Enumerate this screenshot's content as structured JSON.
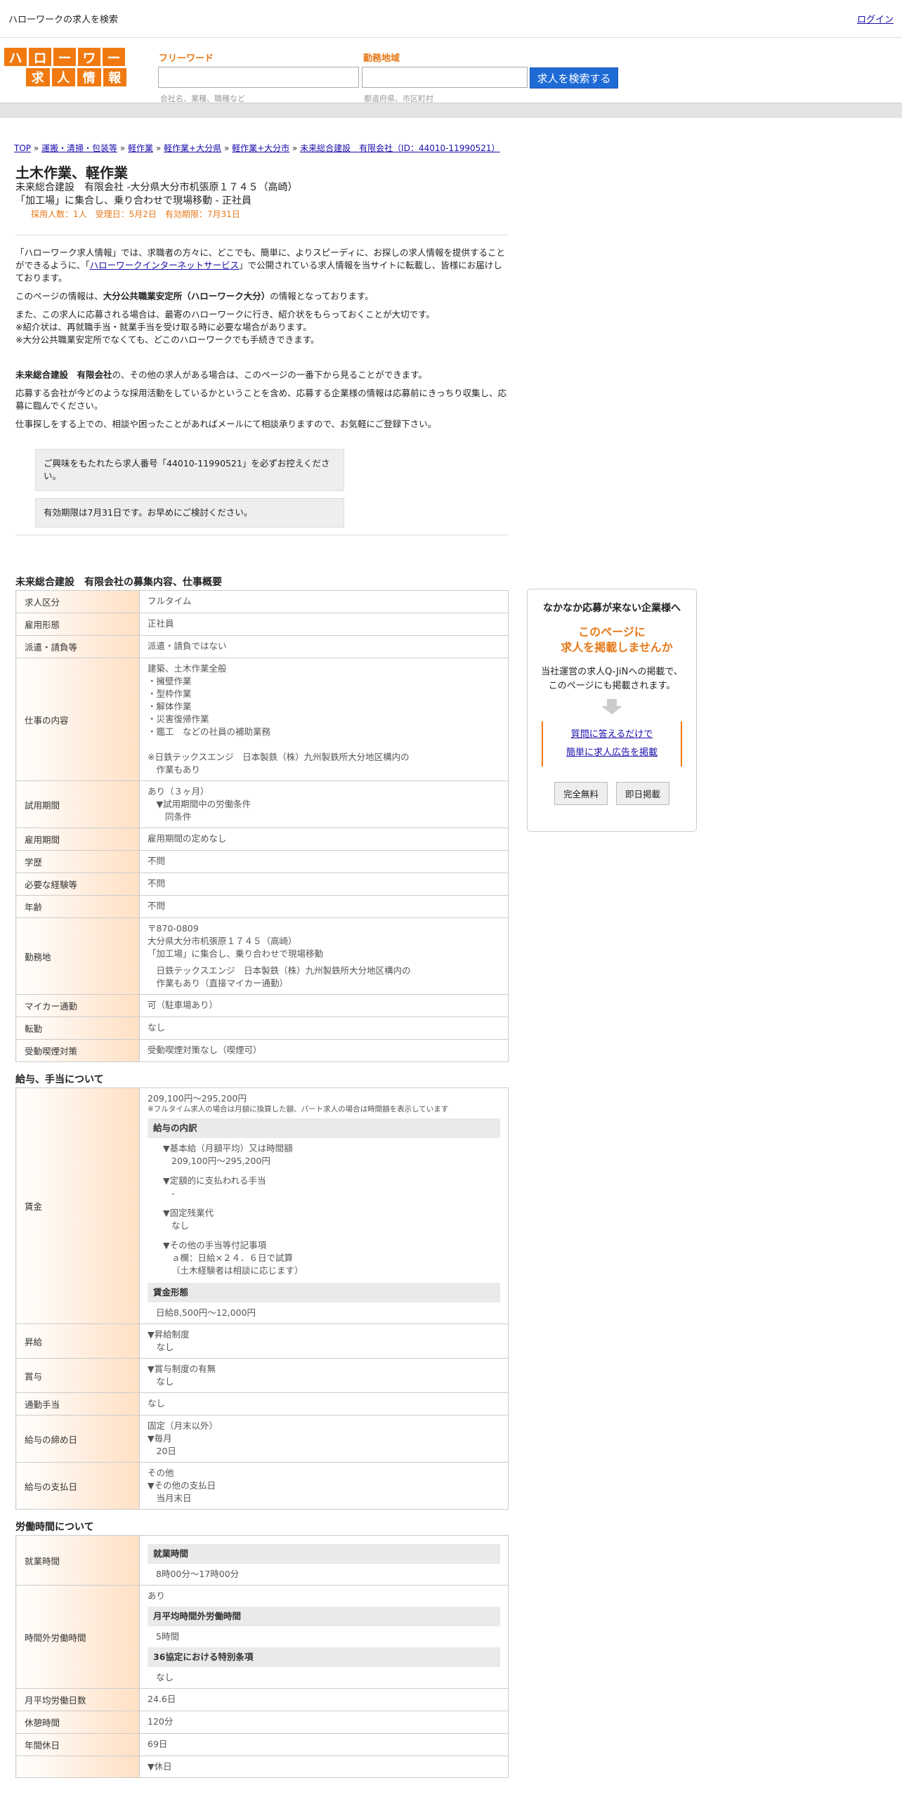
{
  "top": {
    "title": "ハローワークの求人を検索",
    "login": "ログイン"
  },
  "logo": {
    "row1": [
      "ハ",
      "ロ",
      "ー",
      "ワ",
      "ー",
      "ク"
    ],
    "row2": [
      "求",
      "人",
      "情",
      "報"
    ]
  },
  "search": {
    "freeword_label": "フリーワード",
    "freeword_placeholder": "会社名、業種、職種など",
    "area_label": "勤務地域",
    "area_placeholder": "都道府県、市区町村",
    "button": "求人を検索する"
  },
  "breadcrumb": {
    "top": "TOP",
    "sep": "»",
    "c1": "運搬・清掃・包装等",
    "c2": "軽作業",
    "c3": "軽作業+大分県",
    "c4": "軽作業+大分市",
    "c5": "未来総合建設　有限会社（ID：44010-11990521）"
  },
  "job": {
    "title": "土木作業、軽作業",
    "company_line": "未来総合建設　有限会社 -大分県大分市机張原１７４５（高崎）",
    "subtitle": "「加工場」に集合し、乗り合わせで現場移動 - 正社員",
    "meta": "採用人数：1人　受理日：5月2日　有効期限：7月31日"
  },
  "intro": {
    "p1a": "「ハローワーク求人情報」では、求職者の方々に、どこでも、簡単に、よりスピーディに、お探しの求人情報を提供することができるように、「",
    "p1link": "ハローワークインターネットサービス",
    "p1b": "」で公開されている求人情報を当サイトに転載し、皆様にお届けしております。",
    "p2a": "このページの情報は、",
    "p2b": "大分公共職業安定所（ハローワーク大分）",
    "p2c": "の情報となっております。",
    "p3": "また、この求人に応募される場合は、最寄のハローワークに行き、紹介状をもらっておくことが大切です。",
    "p3b": "※紹介状は、再就職手当・就業手当を受け取る時に必要な場合があります。",
    "p3c": "※大分公共職業安定所でなくても、どこのハローワークでも手続きできます。",
    "p4a": "未来総合建設　有限会社",
    "p4b": "の、その他の求人がある場合は、このページの一番下から見ることができます。",
    "p5": "応募する会社が今どのような採用活動をしているかということを含め、応募する企業様の情報は応募前にきっちり収集し、応募に臨んでください。",
    "p6": "仕事探しをする上での、相談や困ったことがあればメールにて相談承りますので、お気軽にご登録下さい。"
  },
  "notices": {
    "n1": "ご興味をもたれたら求人番号「44010-11990521」を必ずお控えください。",
    "n2": "有効期限は7月31日です。お早めにご検討ください。"
  },
  "sections": {
    "s1": "未来総合建設　有限会社の募集内容、仕事概要",
    "s2": "給与、手当について",
    "s3": "労働時間について"
  },
  "t1": {
    "r1": [
      "求人区分",
      "フルタイム"
    ],
    "r2": [
      "雇用形態",
      "正社員"
    ],
    "r3": [
      "派遣・請負等",
      "派遣・請負ではない"
    ],
    "r4h": "仕事の内容",
    "r4": [
      "建築、土木作業全般",
      "・擁壁作業",
      "・型枠作業",
      "・解体作業",
      "・災害復帰作業",
      "・鑑工　などの社員の補助業務",
      "",
      "※日鉄テックスエンジ　日本製鉄（株）九州製鉄所大分地区構内の",
      "　作業もあり"
    ],
    "r5h": "試用期間",
    "r5": [
      "あり（３ヶ月）",
      "　▼試用期間中の労働条件",
      "　　同条件"
    ],
    "r6": [
      "雇用期間",
      "雇用期間の定めなし"
    ],
    "r7": [
      "学歴",
      "不問"
    ],
    "r8": [
      "必要な経験等",
      "不問"
    ],
    "r9": [
      "年齢",
      "不問"
    ],
    "r10h": "勤務地",
    "r10": [
      "〒870-0809",
      "大分県大分市机張原１７４５（高崎）",
      "「加工場」に集合し、乗り合わせで現場移動",
      "",
      "　日鉄テックスエンジ　日本製鉄（株）九州製鉄所大分地区構内の",
      "　作業もあり（直接マイカー通勤）"
    ],
    "r11": [
      "マイカー通勤",
      "可（駐車場あり）"
    ],
    "r12": [
      "転勤",
      "なし"
    ],
    "r13": [
      "受動喫煙対策",
      "受動喫煙対策なし（喫煙可）"
    ]
  },
  "t2": {
    "r1h": "賃金",
    "range": "209,100円〜295,200円",
    "note": "※フルタイム求人の場合は月額に換算した額、パート求人の場合は時間額を表示しています",
    "g1": "給与の内訳",
    "b1": "▼基本給（月額平均）又は時間額",
    "b1v": "209,100円〜295,200円",
    "b2": "▼定額的に支払われる手当",
    "b2v": "-",
    "b3": "▼固定残業代",
    "b3v": "なし",
    "b4": "▼その他の手当等付記事項",
    "b4v": "ａ欄：日給×２４．６日で試算",
    "b4v2": "（土木経験者は相談に応じます）",
    "g2": "賃金形態",
    "g2v": "日給8,500円〜12,000円",
    "r2h": "昇給",
    "r2": [
      "▼昇給制度",
      "　なし"
    ],
    "r3h": "賞与",
    "r3": [
      "▼賞与制度の有無",
      "　なし"
    ],
    "r4": [
      "通勤手当",
      "なし"
    ],
    "r5h": "給与の締め日",
    "r5": [
      "固定（月末以外）",
      "▼毎月",
      "　20日"
    ],
    "r6h": "給与の支払日",
    "r6": [
      "その他",
      "▼その他の支払日",
      "　当月末日"
    ]
  },
  "t3": {
    "r1h": "就業時間",
    "g1": "就業時間",
    "g1v": "8時00分〜17時00分",
    "r2h": "時間外労働時間",
    "r2a": "あり",
    "g2": "月平均時間外労働時間",
    "g2v": "5時間",
    "g3": "36協定における特別条項",
    "g3v": "なし",
    "r3": [
      "月平均労働日数",
      "24.6日"
    ],
    "r4": [
      "休憩時間",
      "120分"
    ],
    "r5": [
      "年間休日",
      "69日"
    ],
    "r6v": "▼休日"
  },
  "side": {
    "title": "なかなか応募が来ない企業様へ",
    "l1": "このページに",
    "l2": "求人を掲載しませんか",
    "d1": "当社運営の求人Q-JiNへの掲載で、",
    "d2": "このページにも掲載されます。",
    "link1": "質問に答えるだけで",
    "link2": "簡単に求人広告を掲載",
    "btn1": "完全無料",
    "btn2": "即日掲載"
  }
}
